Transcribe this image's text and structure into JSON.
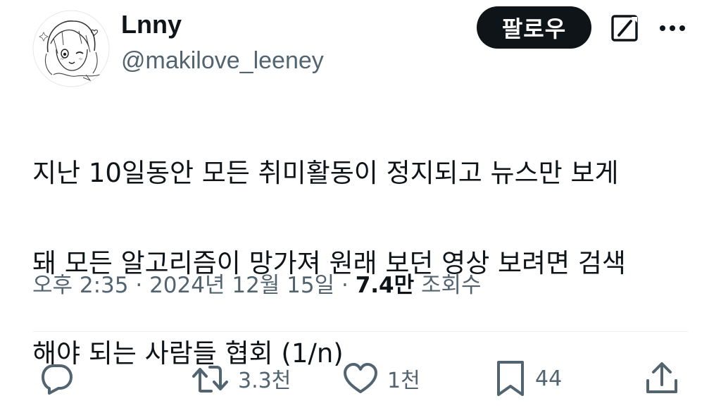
{
  "author": {
    "display_name": "Lnny",
    "handle": "@makilove_leeney",
    "avatar_icon": "anime-sketch-avatar"
  },
  "header": {
    "follow_label": "팔로우",
    "grok_icon": "grok-icon",
    "more_icon": "more-icon"
  },
  "tweet": {
    "text_lines": [
      "지난 10일동안 모든 취미활동이 정지되고 뉴스만 보게",
      "돼 모든 알고리즘이 망가져 원래 보던 영상 보려면 검색",
      "해야 되는 사람들 협회 (1/n)"
    ]
  },
  "meta": {
    "time": "오후 2:35",
    "separator": " · ",
    "date": "2024년 12월 15일",
    "views_count": "7.4만",
    "views_label": "조회수"
  },
  "actions": {
    "reply": {
      "icon": "reply-icon",
      "count": ""
    },
    "retweet": {
      "icon": "retweet-icon",
      "count": "3.3천"
    },
    "like": {
      "icon": "heart-icon",
      "count": "1천"
    },
    "bookmark": {
      "icon": "bookmark-icon",
      "count": "44"
    },
    "share": {
      "icon": "share-icon",
      "count": ""
    }
  },
  "colors": {
    "text_primary": "#0f1419",
    "text_secondary": "#536471",
    "follow_bg": "#0f1419",
    "follow_fg": "#ffffff",
    "divider": "#eff3f4"
  }
}
